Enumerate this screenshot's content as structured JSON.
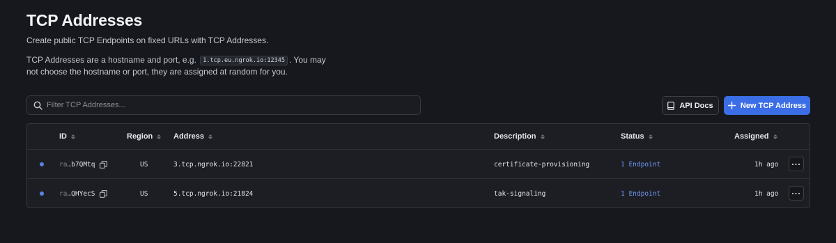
{
  "header": {
    "title": "TCP Addresses",
    "subtitle": "Create public TCP Endpoints on fixed URLs with TCP Addresses.",
    "desc_before": "TCP Addresses are a hostname and port, e.g.",
    "desc_code": "1.tcp.eu.ngrok.io:12345",
    "desc_after": ". You may not choose the hostname or port, they are assigned at random for you."
  },
  "search": {
    "placeholder": "Filter TCP Addresses..."
  },
  "toolbar": {
    "api_docs_label": "API Docs",
    "new_label": "New TCP Address"
  },
  "table": {
    "columns": {
      "id": "ID",
      "region": "Region",
      "address": "Address",
      "description": "Description",
      "status": "Status",
      "assigned": "Assigned"
    },
    "rows": [
      {
        "id_prefix": "ra…",
        "id_suffix": "b7QMtq",
        "region": "US",
        "address": "3.tcp.ngrok.io:22821",
        "description": "certificate-provisioning",
        "status": "1 Endpoint",
        "assigned": "1h ago"
      },
      {
        "id_prefix": "ra…",
        "id_suffix": "QHYecS",
        "region": "US",
        "address": "5.tcp.ngrok.io:21824",
        "description": "tak-signaling",
        "status": "1 Endpoint",
        "assigned": "1h ago"
      }
    ],
    "more_label": "···"
  },
  "colors": {
    "background": "#16181d",
    "accent": "#3b6ee6",
    "link": "#6f96f2",
    "status_dot": "#5b82e0"
  },
  "icons": {
    "search": "search-icon",
    "docs": "book-icon",
    "add": "plus-icon",
    "copy": "copy-icon",
    "sort": "sort-icon",
    "more": "more-icon"
  }
}
